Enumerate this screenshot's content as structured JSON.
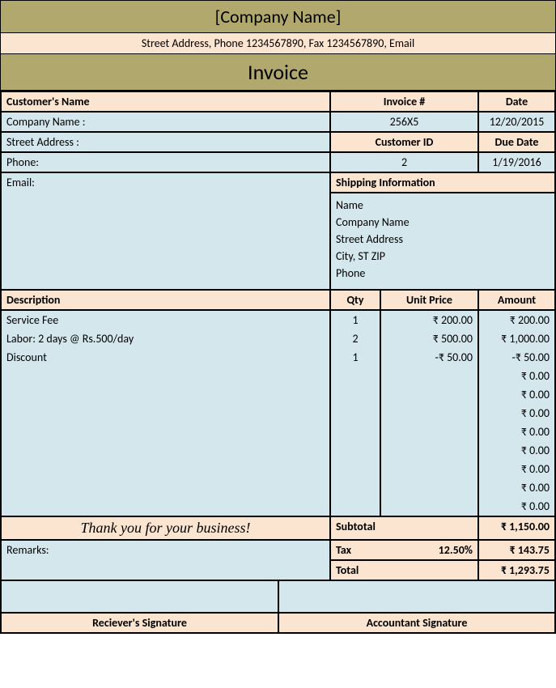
{
  "header": {
    "company": "[Company Name]",
    "address": "Street Address, Phone 1234567890, Fax 1234567890, Email",
    "title": "Invoice"
  },
  "customer": {
    "section_label": "Customer's Name",
    "company_label": "Company Name :",
    "street_label": "Street Address :",
    "phone_label": "Phone:",
    "email_label": "Email:"
  },
  "invoice_meta": {
    "invno_label": "Invoice #",
    "invno": "256X5",
    "date_label": "Date",
    "date": "12/20/2015",
    "custid_label": "Customer ID",
    "custid": "2",
    "due_label": "Due Date",
    "due": "1/19/2016"
  },
  "shipping": {
    "label": "Shipping Information",
    "name": "Name",
    "company": "Company Name",
    "street": "Street Address",
    "city": "City, ST ZIP",
    "phone": "Phone"
  },
  "columns": {
    "desc": "Description",
    "qty": "Qty",
    "price": "Unit Price",
    "amount": "Amount"
  },
  "items": [
    {
      "desc": "Service Fee",
      "qty": "1",
      "price": "₹ 200.00",
      "amount": "₹ 200.00"
    },
    {
      "desc": "Labor: 2 days @ Rs.500/day",
      "qty": "2",
      "price": "₹ 500.00",
      "amount": "₹ 1,000.00"
    },
    {
      "desc": "Discount",
      "qty": "1",
      "price": "-₹ 50.00",
      "amount": "-₹ 50.00"
    },
    {
      "desc": "",
      "qty": "",
      "price": "",
      "amount": "₹ 0.00"
    },
    {
      "desc": "",
      "qty": "",
      "price": "",
      "amount": "₹ 0.00"
    },
    {
      "desc": "",
      "qty": "",
      "price": "",
      "amount": "₹ 0.00"
    },
    {
      "desc": "",
      "qty": "",
      "price": "",
      "amount": "₹ 0.00"
    },
    {
      "desc": "",
      "qty": "",
      "price": "",
      "amount": "₹ 0.00"
    },
    {
      "desc": "",
      "qty": "",
      "price": "",
      "amount": "₹ 0.00"
    },
    {
      "desc": "",
      "qty": "",
      "price": "",
      "amount": "₹ 0.00"
    },
    {
      "desc": "",
      "qty": "",
      "price": "",
      "amount": "₹ 0.00"
    }
  ],
  "thank": "Thank you for your business!",
  "remarks_label": "Remarks:",
  "totals": {
    "subtotal_label": "Subtotal",
    "subtotal": "₹ 1,150.00",
    "tax_label": "Tax",
    "tax_rate": "12.50%",
    "tax": "₹ 143.75",
    "total_label": "Total",
    "total": "₹ 1,293.75"
  },
  "sig": {
    "receiver": "Reciever's Signature",
    "accountant": "Accountant Signature"
  }
}
